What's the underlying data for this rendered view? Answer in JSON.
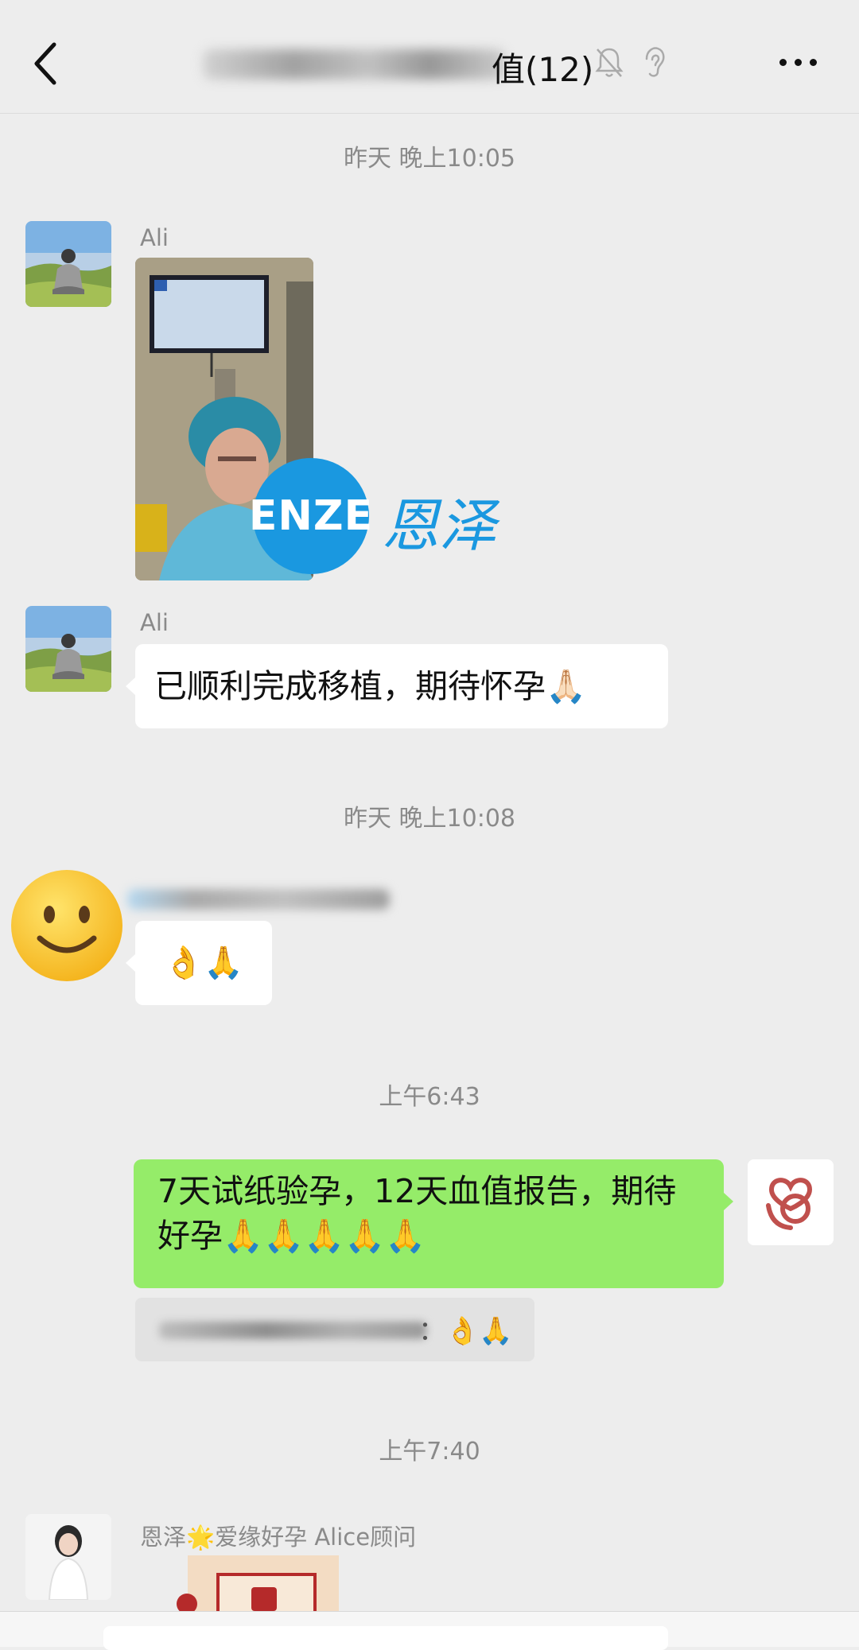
{
  "header": {
    "title_suffix": "值(12)",
    "icons": [
      "back-icon",
      "mute-bell-icon",
      "ear-icon",
      "more-icon"
    ]
  },
  "messages": {
    "ts1": "昨天 晚上10:05",
    "sender_ali_1": "Ali",
    "sender_ali_2": "Ali",
    "ali_text": "已顺利完成移植，期待怀孕🙏🏻",
    "photo_brand_en": "ENZE",
    "photo_brand_cn": "恩泽",
    "ts2": "昨天 晚上10:08",
    "emoji_reply": "👌🙏",
    "ts3": "上午6:43",
    "own_text": "7天试纸验孕，12天血值报告，期待好孕🙏🙏🙏🙏🙏",
    "quote_suffix": "：👌🙏",
    "ts4": "上午7:40",
    "sender_alice": "恩泽🌟爱缘好孕 Alice顾问"
  },
  "colors": {
    "background": "#ededed",
    "bubble_own": "#95ec69",
    "bubble_other": "#ffffff",
    "brand_blue": "#1a98e0"
  }
}
